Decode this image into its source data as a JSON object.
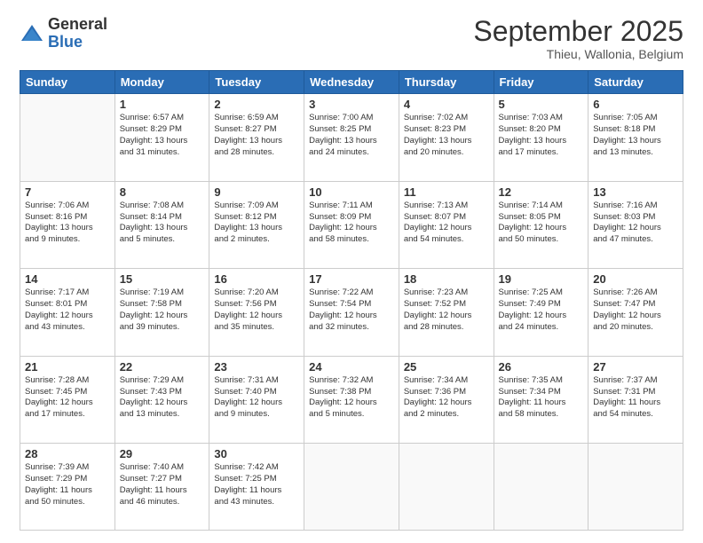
{
  "header": {
    "logo": {
      "general": "General",
      "blue": "Blue"
    },
    "title": "September 2025",
    "subtitle": "Thieu, Wallonia, Belgium"
  },
  "days_of_week": [
    "Sunday",
    "Monday",
    "Tuesday",
    "Wednesday",
    "Thursday",
    "Friday",
    "Saturday"
  ],
  "weeks": [
    [
      {
        "day": "",
        "info": ""
      },
      {
        "day": "1",
        "info": "Sunrise: 6:57 AM\nSunset: 8:29 PM\nDaylight: 13 hours\nand 31 minutes."
      },
      {
        "day": "2",
        "info": "Sunrise: 6:59 AM\nSunset: 8:27 PM\nDaylight: 13 hours\nand 28 minutes."
      },
      {
        "day": "3",
        "info": "Sunrise: 7:00 AM\nSunset: 8:25 PM\nDaylight: 13 hours\nand 24 minutes."
      },
      {
        "day": "4",
        "info": "Sunrise: 7:02 AM\nSunset: 8:23 PM\nDaylight: 13 hours\nand 20 minutes."
      },
      {
        "day": "5",
        "info": "Sunrise: 7:03 AM\nSunset: 8:20 PM\nDaylight: 13 hours\nand 17 minutes."
      },
      {
        "day": "6",
        "info": "Sunrise: 7:05 AM\nSunset: 8:18 PM\nDaylight: 13 hours\nand 13 minutes."
      }
    ],
    [
      {
        "day": "7",
        "info": "Sunrise: 7:06 AM\nSunset: 8:16 PM\nDaylight: 13 hours\nand 9 minutes."
      },
      {
        "day": "8",
        "info": "Sunrise: 7:08 AM\nSunset: 8:14 PM\nDaylight: 13 hours\nand 5 minutes."
      },
      {
        "day": "9",
        "info": "Sunrise: 7:09 AM\nSunset: 8:12 PM\nDaylight: 13 hours\nand 2 minutes."
      },
      {
        "day": "10",
        "info": "Sunrise: 7:11 AM\nSunset: 8:09 PM\nDaylight: 12 hours\nand 58 minutes."
      },
      {
        "day": "11",
        "info": "Sunrise: 7:13 AM\nSunset: 8:07 PM\nDaylight: 12 hours\nand 54 minutes."
      },
      {
        "day": "12",
        "info": "Sunrise: 7:14 AM\nSunset: 8:05 PM\nDaylight: 12 hours\nand 50 minutes."
      },
      {
        "day": "13",
        "info": "Sunrise: 7:16 AM\nSunset: 8:03 PM\nDaylight: 12 hours\nand 47 minutes."
      }
    ],
    [
      {
        "day": "14",
        "info": "Sunrise: 7:17 AM\nSunset: 8:01 PM\nDaylight: 12 hours\nand 43 minutes."
      },
      {
        "day": "15",
        "info": "Sunrise: 7:19 AM\nSunset: 7:58 PM\nDaylight: 12 hours\nand 39 minutes."
      },
      {
        "day": "16",
        "info": "Sunrise: 7:20 AM\nSunset: 7:56 PM\nDaylight: 12 hours\nand 35 minutes."
      },
      {
        "day": "17",
        "info": "Sunrise: 7:22 AM\nSunset: 7:54 PM\nDaylight: 12 hours\nand 32 minutes."
      },
      {
        "day": "18",
        "info": "Sunrise: 7:23 AM\nSunset: 7:52 PM\nDaylight: 12 hours\nand 28 minutes."
      },
      {
        "day": "19",
        "info": "Sunrise: 7:25 AM\nSunset: 7:49 PM\nDaylight: 12 hours\nand 24 minutes."
      },
      {
        "day": "20",
        "info": "Sunrise: 7:26 AM\nSunset: 7:47 PM\nDaylight: 12 hours\nand 20 minutes."
      }
    ],
    [
      {
        "day": "21",
        "info": "Sunrise: 7:28 AM\nSunset: 7:45 PM\nDaylight: 12 hours\nand 17 minutes."
      },
      {
        "day": "22",
        "info": "Sunrise: 7:29 AM\nSunset: 7:43 PM\nDaylight: 12 hours\nand 13 minutes."
      },
      {
        "day": "23",
        "info": "Sunrise: 7:31 AM\nSunset: 7:40 PM\nDaylight: 12 hours\nand 9 minutes."
      },
      {
        "day": "24",
        "info": "Sunrise: 7:32 AM\nSunset: 7:38 PM\nDaylight: 12 hours\nand 5 minutes."
      },
      {
        "day": "25",
        "info": "Sunrise: 7:34 AM\nSunset: 7:36 PM\nDaylight: 12 hours\nand 2 minutes."
      },
      {
        "day": "26",
        "info": "Sunrise: 7:35 AM\nSunset: 7:34 PM\nDaylight: 11 hours\nand 58 minutes."
      },
      {
        "day": "27",
        "info": "Sunrise: 7:37 AM\nSunset: 7:31 PM\nDaylight: 11 hours\nand 54 minutes."
      }
    ],
    [
      {
        "day": "28",
        "info": "Sunrise: 7:39 AM\nSunset: 7:29 PM\nDaylight: 11 hours\nand 50 minutes."
      },
      {
        "day": "29",
        "info": "Sunrise: 7:40 AM\nSunset: 7:27 PM\nDaylight: 11 hours\nand 46 minutes."
      },
      {
        "day": "30",
        "info": "Sunrise: 7:42 AM\nSunset: 7:25 PM\nDaylight: 11 hours\nand 43 minutes."
      },
      {
        "day": "",
        "info": ""
      },
      {
        "day": "",
        "info": ""
      },
      {
        "day": "",
        "info": ""
      },
      {
        "day": "",
        "info": ""
      }
    ]
  ]
}
